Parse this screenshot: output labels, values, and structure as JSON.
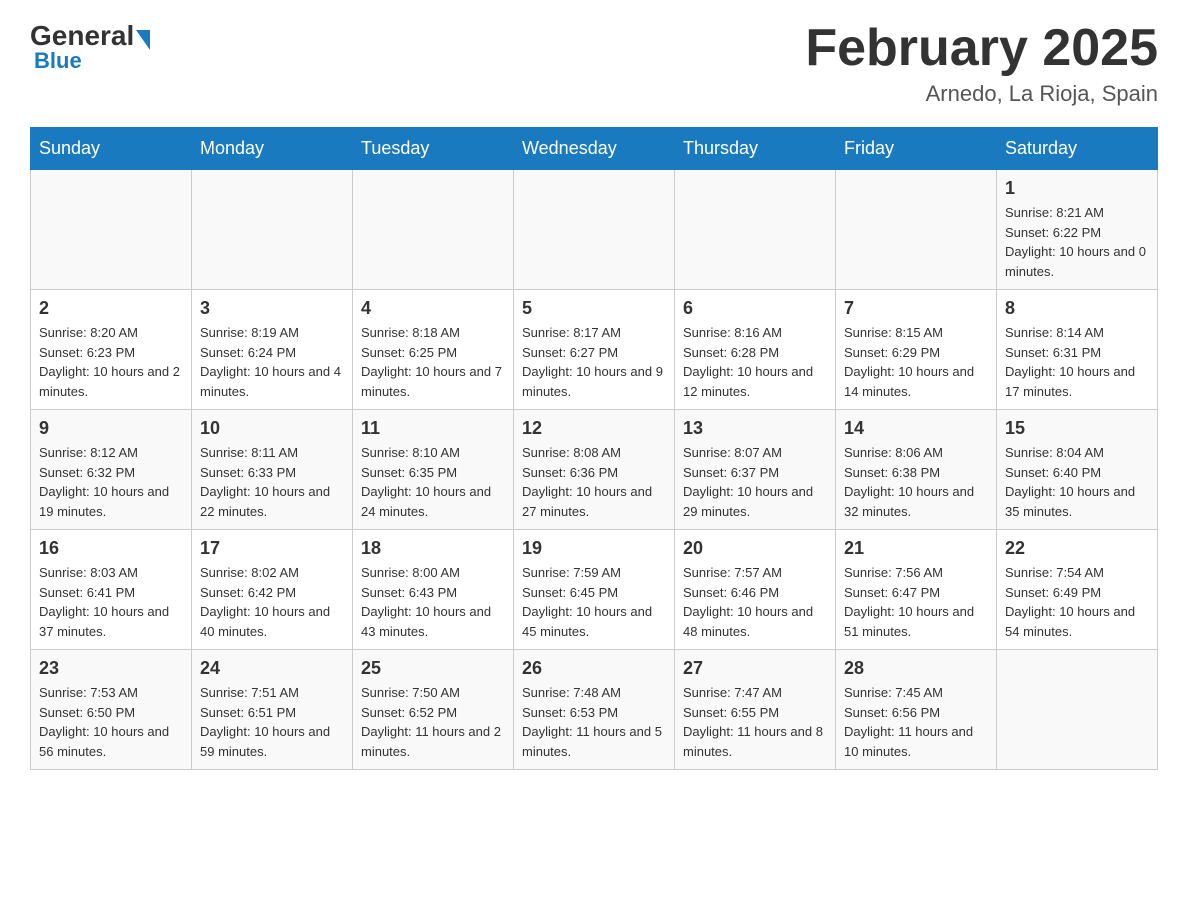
{
  "logo": {
    "general": "General",
    "blue": "Blue"
  },
  "header": {
    "month_title": "February 2025",
    "location": "Arnedo, La Rioja, Spain"
  },
  "weekdays": [
    "Sunday",
    "Monday",
    "Tuesday",
    "Wednesday",
    "Thursday",
    "Friday",
    "Saturday"
  ],
  "weeks": [
    [
      {
        "day": "",
        "info": ""
      },
      {
        "day": "",
        "info": ""
      },
      {
        "day": "",
        "info": ""
      },
      {
        "day": "",
        "info": ""
      },
      {
        "day": "",
        "info": ""
      },
      {
        "day": "",
        "info": ""
      },
      {
        "day": "1",
        "info": "Sunrise: 8:21 AM\nSunset: 6:22 PM\nDaylight: 10 hours and 0 minutes."
      }
    ],
    [
      {
        "day": "2",
        "info": "Sunrise: 8:20 AM\nSunset: 6:23 PM\nDaylight: 10 hours and 2 minutes."
      },
      {
        "day": "3",
        "info": "Sunrise: 8:19 AM\nSunset: 6:24 PM\nDaylight: 10 hours and 4 minutes."
      },
      {
        "day": "4",
        "info": "Sunrise: 8:18 AM\nSunset: 6:25 PM\nDaylight: 10 hours and 7 minutes."
      },
      {
        "day": "5",
        "info": "Sunrise: 8:17 AM\nSunset: 6:27 PM\nDaylight: 10 hours and 9 minutes."
      },
      {
        "day": "6",
        "info": "Sunrise: 8:16 AM\nSunset: 6:28 PM\nDaylight: 10 hours and 12 minutes."
      },
      {
        "day": "7",
        "info": "Sunrise: 8:15 AM\nSunset: 6:29 PM\nDaylight: 10 hours and 14 minutes."
      },
      {
        "day": "8",
        "info": "Sunrise: 8:14 AM\nSunset: 6:31 PM\nDaylight: 10 hours and 17 minutes."
      }
    ],
    [
      {
        "day": "9",
        "info": "Sunrise: 8:12 AM\nSunset: 6:32 PM\nDaylight: 10 hours and 19 minutes."
      },
      {
        "day": "10",
        "info": "Sunrise: 8:11 AM\nSunset: 6:33 PM\nDaylight: 10 hours and 22 minutes."
      },
      {
        "day": "11",
        "info": "Sunrise: 8:10 AM\nSunset: 6:35 PM\nDaylight: 10 hours and 24 minutes."
      },
      {
        "day": "12",
        "info": "Sunrise: 8:08 AM\nSunset: 6:36 PM\nDaylight: 10 hours and 27 minutes."
      },
      {
        "day": "13",
        "info": "Sunrise: 8:07 AM\nSunset: 6:37 PM\nDaylight: 10 hours and 29 minutes."
      },
      {
        "day": "14",
        "info": "Sunrise: 8:06 AM\nSunset: 6:38 PM\nDaylight: 10 hours and 32 minutes."
      },
      {
        "day": "15",
        "info": "Sunrise: 8:04 AM\nSunset: 6:40 PM\nDaylight: 10 hours and 35 minutes."
      }
    ],
    [
      {
        "day": "16",
        "info": "Sunrise: 8:03 AM\nSunset: 6:41 PM\nDaylight: 10 hours and 37 minutes."
      },
      {
        "day": "17",
        "info": "Sunrise: 8:02 AM\nSunset: 6:42 PM\nDaylight: 10 hours and 40 minutes."
      },
      {
        "day": "18",
        "info": "Sunrise: 8:00 AM\nSunset: 6:43 PM\nDaylight: 10 hours and 43 minutes."
      },
      {
        "day": "19",
        "info": "Sunrise: 7:59 AM\nSunset: 6:45 PM\nDaylight: 10 hours and 45 minutes."
      },
      {
        "day": "20",
        "info": "Sunrise: 7:57 AM\nSunset: 6:46 PM\nDaylight: 10 hours and 48 minutes."
      },
      {
        "day": "21",
        "info": "Sunrise: 7:56 AM\nSunset: 6:47 PM\nDaylight: 10 hours and 51 minutes."
      },
      {
        "day": "22",
        "info": "Sunrise: 7:54 AM\nSunset: 6:49 PM\nDaylight: 10 hours and 54 minutes."
      }
    ],
    [
      {
        "day": "23",
        "info": "Sunrise: 7:53 AM\nSunset: 6:50 PM\nDaylight: 10 hours and 56 minutes."
      },
      {
        "day": "24",
        "info": "Sunrise: 7:51 AM\nSunset: 6:51 PM\nDaylight: 10 hours and 59 minutes."
      },
      {
        "day": "25",
        "info": "Sunrise: 7:50 AM\nSunset: 6:52 PM\nDaylight: 11 hours and 2 minutes."
      },
      {
        "day": "26",
        "info": "Sunrise: 7:48 AM\nSunset: 6:53 PM\nDaylight: 11 hours and 5 minutes."
      },
      {
        "day": "27",
        "info": "Sunrise: 7:47 AM\nSunset: 6:55 PM\nDaylight: 11 hours and 8 minutes."
      },
      {
        "day": "28",
        "info": "Sunrise: 7:45 AM\nSunset: 6:56 PM\nDaylight: 11 hours and 10 minutes."
      },
      {
        "day": "",
        "info": ""
      }
    ]
  ]
}
